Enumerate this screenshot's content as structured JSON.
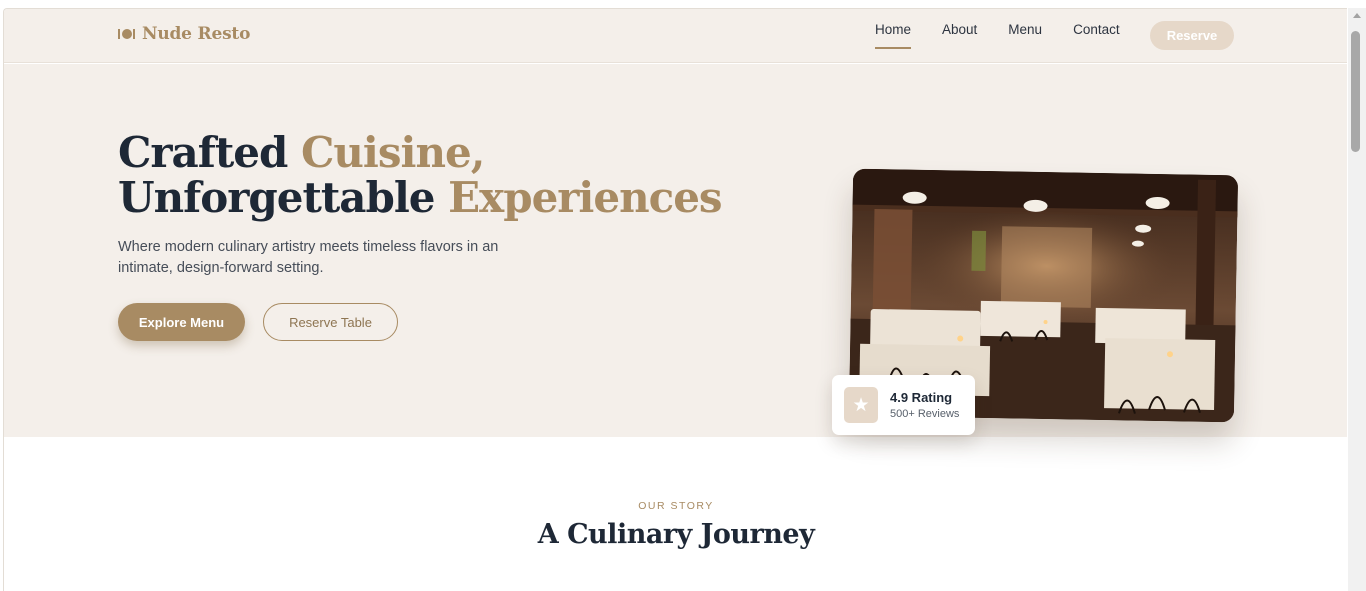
{
  "brand": {
    "name": "Nude Resto",
    "icon": "plate-cutlery-icon"
  },
  "nav": {
    "links": [
      {
        "label": "Home",
        "active": true
      },
      {
        "label": "About",
        "active": false
      },
      {
        "label": "Menu",
        "active": false
      },
      {
        "label": "Contact",
        "active": false
      }
    ],
    "reserve_label": "Reserve"
  },
  "hero": {
    "headline_line1_a": "Crafted ",
    "headline_line1_b": "Cuisine,",
    "headline_line2_a": "Unforgettable ",
    "headline_line2_b": "Experiences",
    "subtitle": "Where modern culinary artistry meets timeless flavors in an intimate, design-forward setting.",
    "primary_button": "Explore Menu",
    "secondary_button": "Reserve Table",
    "rating": {
      "title": "4.9 Rating",
      "subtitle": "500+ Reviews",
      "icon": "star-icon"
    }
  },
  "story": {
    "label": "OUR STORY",
    "title": "A Culinary Journey"
  },
  "colors": {
    "accent": "#a88b63",
    "hero_bg": "#f4efea",
    "text_dark": "#1e2836",
    "reserve_bg": "#e6d8c9"
  }
}
